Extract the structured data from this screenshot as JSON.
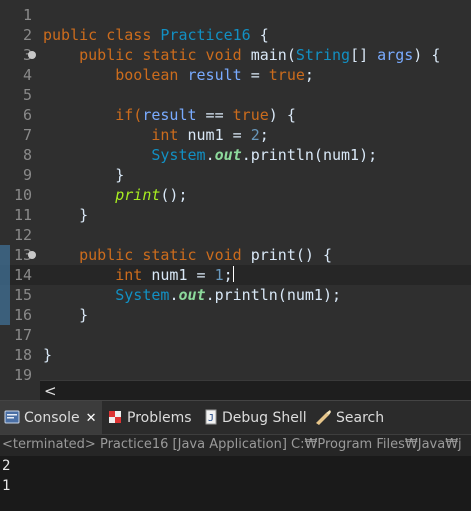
{
  "editor": {
    "lines": [
      {
        "n": "1"
      },
      {
        "n": "2",
        "t": [
          "public class ",
          "Practice16",
          " {"
        ]
      },
      {
        "n": "3",
        "t": [
          "    public static void ",
          "main",
          "(",
          "String",
          "[] ",
          "args",
          ") {"
        ]
      },
      {
        "n": "4",
        "t": [
          "        boolean ",
          "result",
          " = ",
          "true",
          ";"
        ]
      },
      {
        "n": "5"
      },
      {
        "n": "6",
        "t": [
          "        if(",
          "result",
          " == ",
          "true",
          ") {"
        ]
      },
      {
        "n": "7",
        "t": [
          "            int ",
          "num1",
          " = ",
          "2",
          ";"
        ]
      },
      {
        "n": "8",
        "t": [
          "            ",
          "System",
          ".",
          "out",
          ".println(",
          "num1",
          ");"
        ]
      },
      {
        "n": "9",
        "t": [
          "        }"
        ]
      },
      {
        "n": "10",
        "t": [
          "        ",
          "print",
          "();"
        ]
      },
      {
        "n": "11",
        "t": [
          "    }"
        ]
      },
      {
        "n": "12"
      },
      {
        "n": "13",
        "t": [
          "    public static void ",
          "print",
          "() {"
        ]
      },
      {
        "n": "14",
        "t": [
          "        int ",
          "num1",
          " = ",
          "1",
          ";"
        ]
      },
      {
        "n": "15",
        "t": [
          "        ",
          "System",
          ".",
          "out",
          ".println(",
          "num1",
          ");"
        ]
      },
      {
        "n": "16",
        "t": [
          "    }"
        ]
      },
      {
        "n": "17"
      },
      {
        "n": "18",
        "t": [
          "}"
        ]
      },
      {
        "n": "19"
      }
    ]
  },
  "scrollbar": {
    "left_arrow": "<"
  },
  "tabs": {
    "console": "Console",
    "console_close": "✕",
    "problems": "Problems",
    "debug_shell": "Debug Shell",
    "search": "Search"
  },
  "console": {
    "status": "<terminated> Practice16 [Java Application] C:₩Program Files₩Java₩j",
    "output": [
      "2",
      "1"
    ]
  },
  "colors": {
    "keyword": "#cc6c1d",
    "class": "#1290c3",
    "variable": "#79abff",
    "static_field": "#8dda9c",
    "static_method_call": "#a7ec21",
    "number": "#6897bb",
    "editor_bg": "#2f2f2f",
    "console_bg": "#1a1a1a"
  }
}
